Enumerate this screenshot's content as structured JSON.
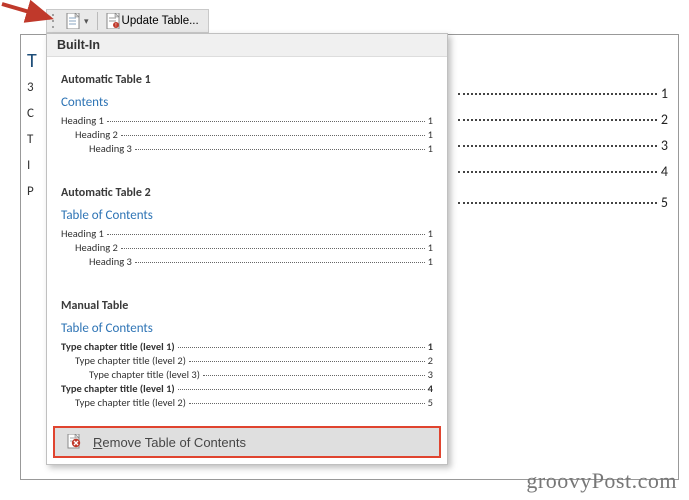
{
  "toolbar": {
    "toc_dropdown_label": "",
    "update_table_label": "Update Table..."
  },
  "bg_doc": {
    "title_fragment": "T",
    "left_chars": [
      "3",
      "C",
      "T",
      "I",
      "",
      "P"
    ],
    "page_numbers": [
      "1",
      "2",
      "3",
      "4",
      "5"
    ]
  },
  "gallery": {
    "section_header": "Built-In",
    "auto1": {
      "title": "Automatic Table 1",
      "caption": "Contents",
      "rows": [
        {
          "label": "Heading 1",
          "page": "1",
          "indent": 0
        },
        {
          "label": "Heading 2",
          "page": "1",
          "indent": 1
        },
        {
          "label": "Heading 3",
          "page": "1",
          "indent": 2
        }
      ]
    },
    "auto2": {
      "title": "Automatic Table 2",
      "caption": "Table of Contents",
      "rows": [
        {
          "label": "Heading 1",
          "page": "1",
          "indent": 0
        },
        {
          "label": "Heading 2",
          "page": "1",
          "indent": 1
        },
        {
          "label": "Heading 3",
          "page": "1",
          "indent": 2
        }
      ]
    },
    "manual": {
      "title": "Manual Table",
      "caption": "Table of Contents",
      "rows": [
        {
          "label": "Type chapter title (level 1)",
          "page": "1",
          "indent": 0,
          "bold": true
        },
        {
          "label": "Type chapter title (level 2)",
          "page": "2",
          "indent": 1
        },
        {
          "label": "Type chapter title (level 3)",
          "page": "3",
          "indent": 2
        },
        {
          "label": "Type chapter title (level 1)",
          "page": "4",
          "indent": 0,
          "bold": true
        },
        {
          "label": "Type chapter title (level 2)",
          "page": "5",
          "indent": 1
        }
      ]
    },
    "remove_label": "Remove Table of Contents"
  },
  "watermark": "groovyPost.com",
  "colors": {
    "accent_link": "#2E74B5",
    "highlight_border": "#e0442f",
    "arrow": "#c0392b"
  }
}
